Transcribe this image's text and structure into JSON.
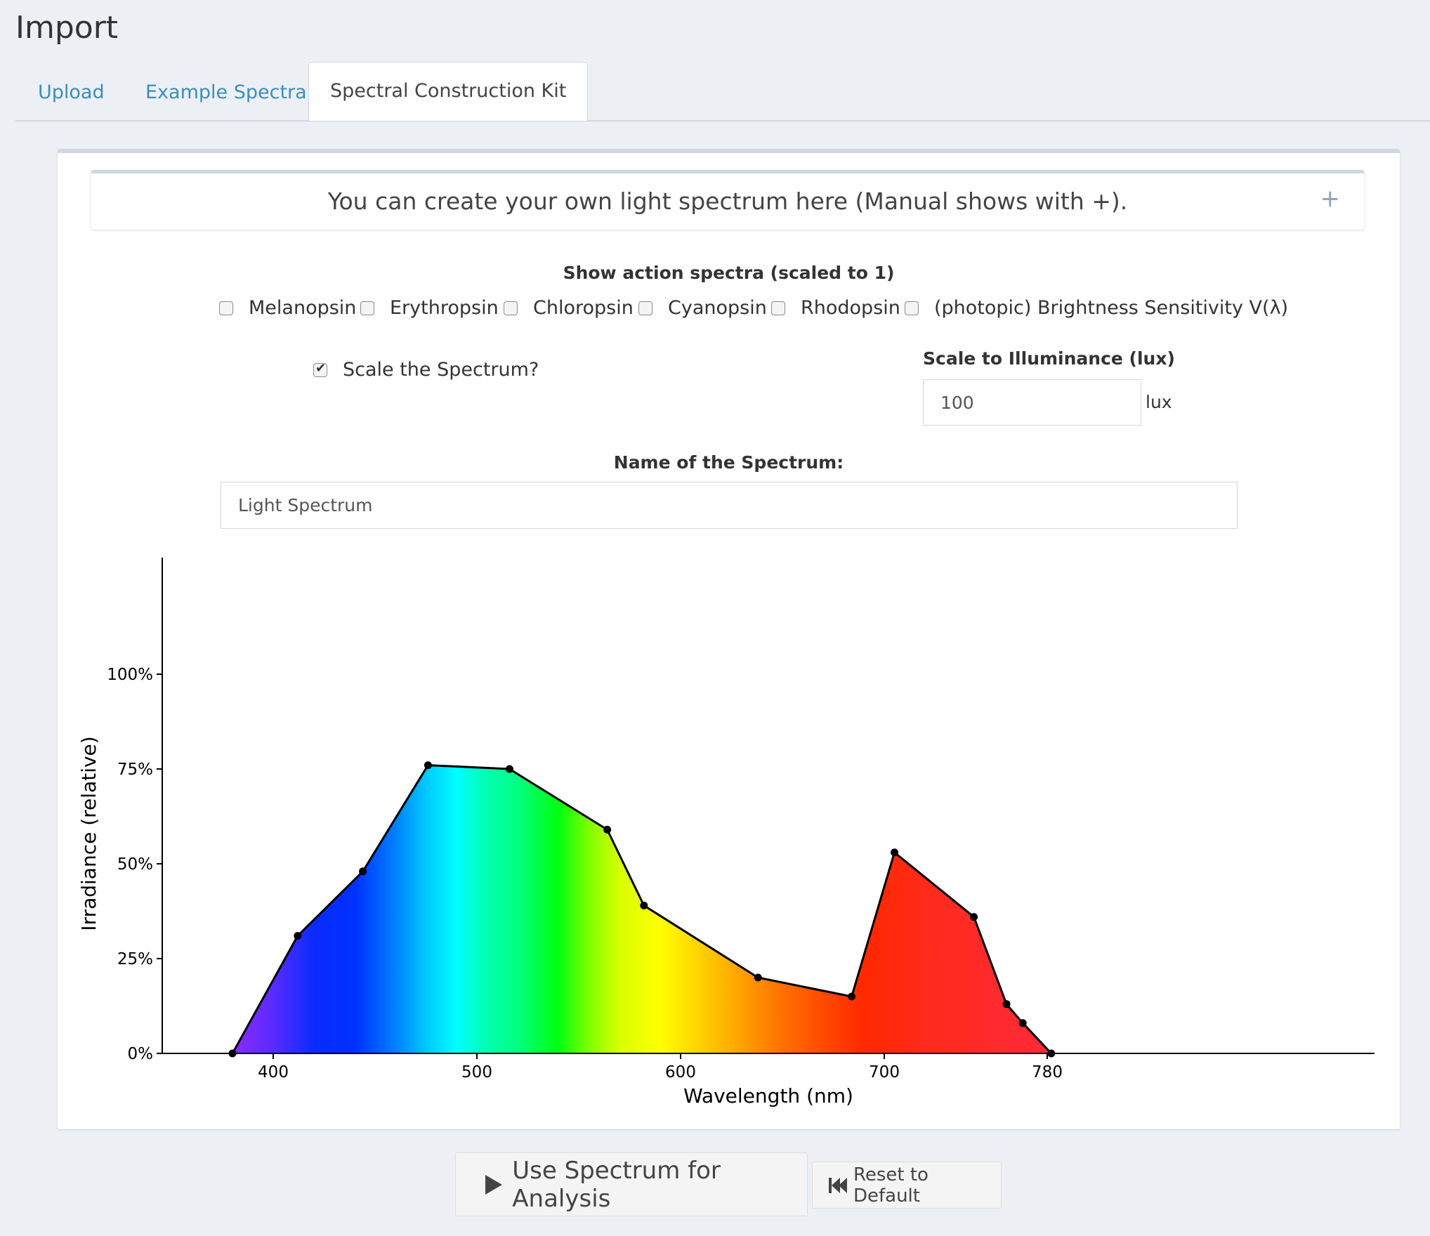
{
  "page": {
    "title": "Import"
  },
  "tabs": [
    {
      "label": "Upload"
    },
    {
      "label": "Example Spectra"
    },
    {
      "label": "Spectral Construction Kit"
    }
  ],
  "info": {
    "text": "You can create your own light spectrum here (Manual shows with +).",
    "expand_icon": "+"
  },
  "action_spectra": {
    "label": "Show action spectra (scaled to 1)",
    "options": [
      {
        "label": "Melanopsin",
        "checked": false
      },
      {
        "label": "Erythropsin",
        "checked": false
      },
      {
        "label": "Chloropsin",
        "checked": false
      },
      {
        "label": "Cyanopsin",
        "checked": false
      },
      {
        "label": "Rhodopsin",
        "checked": false
      },
      {
        "label": "(photopic) Brightness Sensitivity V(λ)",
        "checked": false
      }
    ]
  },
  "scale": {
    "checkbox_label": "Scale the Spectrum?",
    "checked": true,
    "illuminance_label": "Scale to Illuminance (lux)",
    "illuminance_value": "100",
    "unit": "lux"
  },
  "name": {
    "label": "Name of the Spectrum:",
    "value": "Light Spectrum"
  },
  "chart_data": {
    "type": "area",
    "xlabel": "Wavelength (nm)",
    "ylabel": "Irradiance (relative)",
    "xlim": [
      340,
      800
    ],
    "ylim": [
      0,
      1.0
    ],
    "x_ticks": [
      400,
      500,
      600,
      700,
      780
    ],
    "y_ticks": [
      {
        "value": 0,
        "label": "0%"
      },
      {
        "value": 0.25,
        "label": "25%"
      },
      {
        "value": 0.5,
        "label": "50%"
      },
      {
        "value": 0.75,
        "label": "75%"
      },
      {
        "value": 1.0,
        "label": "100%"
      }
    ],
    "points": [
      {
        "x": 380,
        "y": 0.0
      },
      {
        "x": 412,
        "y": 0.31
      },
      {
        "x": 444,
        "y": 0.48
      },
      {
        "x": 476,
        "y": 0.76
      },
      {
        "x": 516,
        "y": 0.75
      },
      {
        "x": 564,
        "y": 0.59
      },
      {
        "x": 582,
        "y": 0.39
      },
      {
        "x": 638,
        "y": 0.2
      },
      {
        "x": 684,
        "y": 0.15
      },
      {
        "x": 705,
        "y": 0.53
      },
      {
        "x": 744,
        "y": 0.36
      },
      {
        "x": 760,
        "y": 0.13
      },
      {
        "x": 768,
        "y": 0.08
      },
      {
        "x": 782,
        "y": 0.0
      }
    ],
    "grid": false
  },
  "buttons": {
    "use": {
      "label": "Use Spectrum for Analysis",
      "icon": "play-icon"
    },
    "reset": {
      "label": "Reset to Default",
      "icon": "fast-backward-icon"
    }
  }
}
